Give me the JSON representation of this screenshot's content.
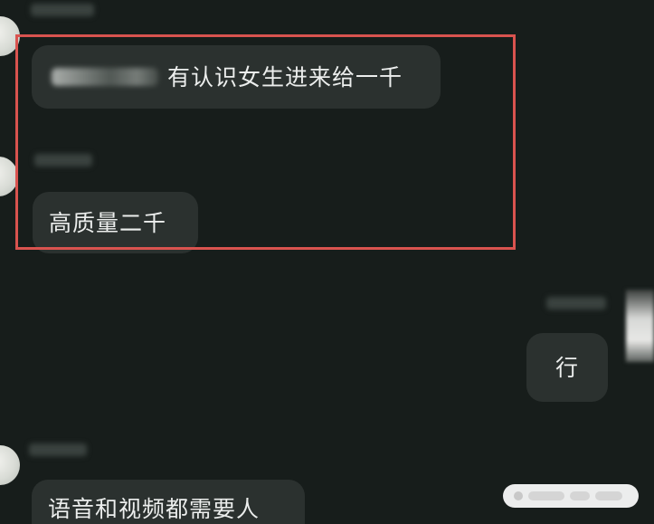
{
  "messages": [
    {
      "sender": "other",
      "mention": "@",
      "text": "有认识女生进来给一千"
    },
    {
      "sender": "other",
      "text": "高质量二千"
    },
    {
      "sender": "self",
      "text": "行"
    },
    {
      "sender": "other",
      "text": "语音和视频都需要人"
    }
  ]
}
